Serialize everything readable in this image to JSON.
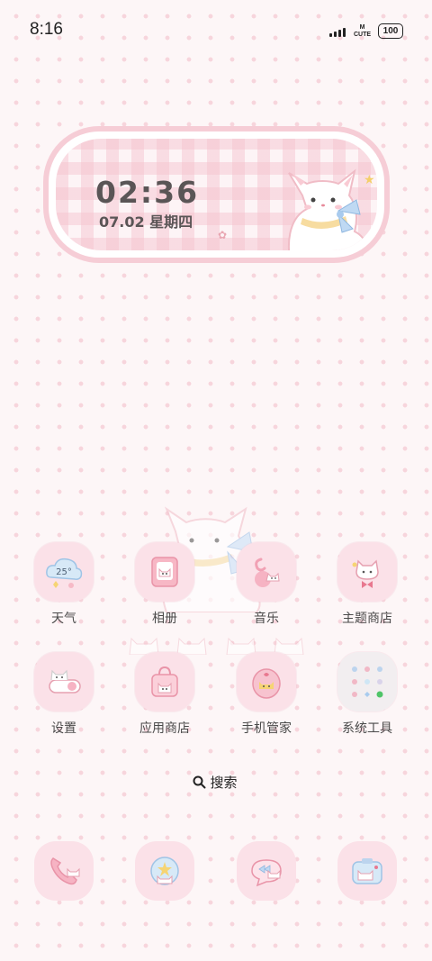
{
  "status_bar": {
    "time": "8:16",
    "carrier": [
      "M",
      "CUTE"
    ],
    "battery": "100"
  },
  "clock_widget": {
    "time": "02:36",
    "date": "07.02  星期四"
  },
  "apps": [
    {
      "label": "天气",
      "icon": "weather-icon",
      "icon_text": "25°"
    },
    {
      "label": "相册",
      "icon": "gallery-icon"
    },
    {
      "label": "音乐",
      "icon": "music-icon"
    },
    {
      "label": "主题商店",
      "icon": "theme-store-icon"
    },
    {
      "label": "设置",
      "icon": "settings-icon"
    },
    {
      "label": "应用商店",
      "icon": "app-store-icon"
    },
    {
      "label": "手机管家",
      "icon": "phone-manager-icon"
    },
    {
      "label": "系统工具",
      "icon": "system-tools-folder-icon"
    }
  ],
  "search": {
    "label": "搜索",
    "icon": "search-icon"
  },
  "dock": [
    {
      "icon": "phone-icon"
    },
    {
      "icon": "browser-icon"
    },
    {
      "icon": "messages-icon"
    },
    {
      "icon": "camera-icon"
    }
  ],
  "colors": {
    "background": "#fdf6f7",
    "dots": "#f7d5dc",
    "icon_bg": "#fbe1e8",
    "widget_border": "#f6cdd6",
    "clock_text": "#5a5556"
  }
}
